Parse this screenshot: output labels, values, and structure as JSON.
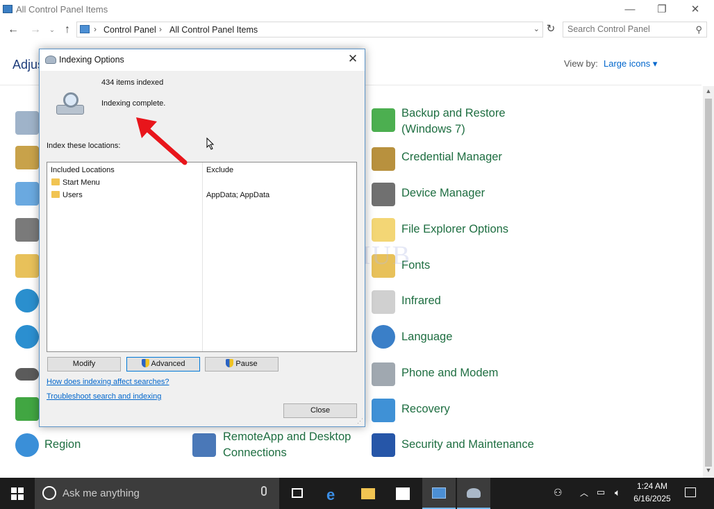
{
  "window": {
    "title": "All Control Panel Items",
    "minimize": "—",
    "maximize": "❐",
    "close": "✕"
  },
  "address": {
    "crumbs": [
      "Control Panel",
      "All Control Panel Items"
    ],
    "search_placeholder": "Search Control Panel"
  },
  "header": {
    "adjust_label": "Adjus",
    "view_by_label": "View by:",
    "view_by_value": "Large icons ▾"
  },
  "items_right": [
    {
      "label": "Backup and Restore\n(Windows 7)",
      "line1": "Backup and Restore",
      "line2": "(Windows 7)",
      "icon": "backup-restore-icon"
    },
    {
      "label": "Credential Manager",
      "icon": "credential-manager-icon"
    },
    {
      "label": "Device Manager",
      "icon": "device-manager-icon"
    },
    {
      "label": "File Explorer Options",
      "icon": "file-explorer-options-icon"
    },
    {
      "label": "Fonts",
      "icon": "fonts-icon"
    },
    {
      "label": "Infrared",
      "icon": "infrared-icon"
    },
    {
      "label": "Language",
      "icon": "language-icon"
    },
    {
      "label": "Phone and Modem",
      "icon": "phone-modem-icon"
    },
    {
      "label": "Recovery",
      "icon": "recovery-icon"
    },
    {
      "label": "Security and Maintenance",
      "icon": "security-maintenance-icon"
    }
  ],
  "items_bottom": [
    {
      "label": "Region",
      "icon": "region-icon"
    },
    {
      "line1": "RemoteApp and Desktop",
      "line2": "Connections",
      "icon": "remoteapp-icon"
    }
  ],
  "dialog": {
    "title": "Indexing Options",
    "items_indexed": "434 items indexed",
    "status": "Indexing complete.",
    "index_locations_label": "Index these locations:",
    "columns": [
      "Included Locations",
      "Exclude"
    ],
    "rows": [
      {
        "location": "Start Menu",
        "exclude": ""
      },
      {
        "location": "Users",
        "exclude": "AppData; AppData"
      }
    ],
    "buttons": {
      "modify": "Modify",
      "advanced": "Advanced",
      "pause": "Pause",
      "close": "Close"
    },
    "links": {
      "how": "How does indexing affect searches?",
      "troubleshoot": "Troubleshoot search and indexing"
    }
  },
  "watermark": "IT Pros HUB",
  "taskbar": {
    "search_text": "Ask me anything",
    "time": "1:24 AM",
    "date": "6/16/2025"
  },
  "colors": {
    "link": "#0066cc",
    "item_label": "#1e6e41",
    "arrow": "#e8151b",
    "taskbar": "#1c1c1c"
  }
}
